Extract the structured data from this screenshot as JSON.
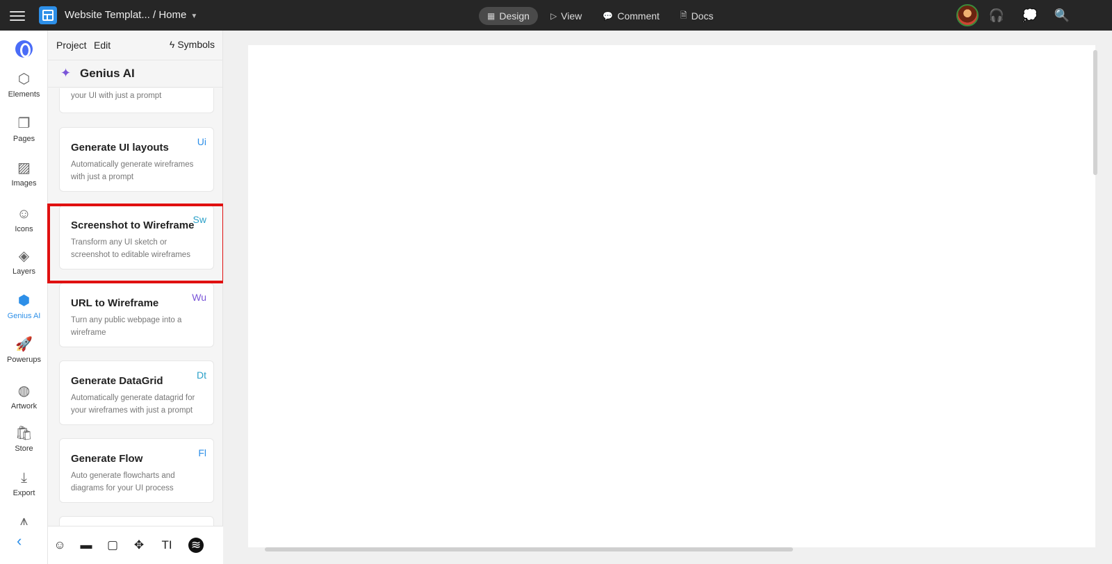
{
  "topbar": {
    "title": "Website Templat... / Home",
    "modes": [
      {
        "label": "Design",
        "icon": "layout-icon",
        "active": true
      },
      {
        "label": "View",
        "icon": "play-icon"
      },
      {
        "label": "Comment",
        "icon": "comment-icon"
      },
      {
        "label": "Docs",
        "icon": "document-icon"
      }
    ]
  },
  "rail": {
    "items": [
      {
        "label": "Elements",
        "icon": "cube-icon"
      },
      {
        "label": "Pages",
        "icon": "pages-icon"
      },
      {
        "label": "Images",
        "icon": "image-icon"
      },
      {
        "label": "Icons",
        "icon": "smiley-icon"
      },
      {
        "label": "Layers",
        "icon": "layers-icon"
      },
      {
        "label": "Genius AI",
        "icon": "genius-ai-icon",
        "active": true
      },
      {
        "label": "Powerups",
        "icon": "rocket-icon"
      },
      {
        "label": "Artwork",
        "icon": "basketball-icon"
      },
      {
        "label": "Store",
        "icon": "shopping-bag-icon"
      },
      {
        "label": "Export",
        "icon": "download-icon"
      }
    ]
  },
  "panel": {
    "tabs": [
      "Project",
      "Edit"
    ],
    "symbols_label": "Symbols",
    "title": "Genius AI",
    "partial_card_desc": "your UI with just a prompt",
    "cards": [
      {
        "title": "Generate UI layouts",
        "desc": "Automatically generate wireframes with just a prompt",
        "badge": "Ui"
      },
      {
        "title": "Screenshot to Wireframe",
        "desc": "Transform any UI sketch or screenshot to editable wireframes",
        "badge": "Sw"
      },
      {
        "title": "URL to Wireframe",
        "desc": "Turn any public webpage into a wireframe",
        "badge": "Wu"
      },
      {
        "title": "Generate DataGrid",
        "desc": "Automatically generate datagrid for your wireframes with just a prompt",
        "badge": "Dt"
      },
      {
        "title": "Generate Flow",
        "desc": "Auto generate flowcharts and diagrams for your UI process",
        "badge": "Fl"
      }
    ],
    "bottom_tools": [
      "smiley-icon",
      "line-icon",
      "rectangle-icon",
      "move-icon",
      "text-icon",
      "stack-icon"
    ]
  },
  "colors": {
    "accent": "#2d8fe8",
    "highlight": "#e01010",
    "topbar": "#262626",
    "genius": "#7a55d8"
  }
}
